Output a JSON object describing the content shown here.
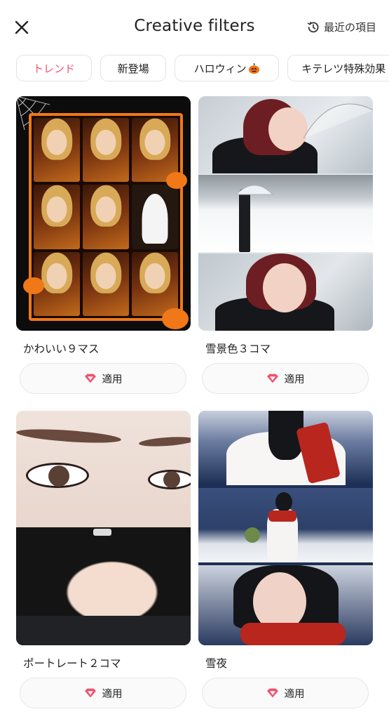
{
  "header": {
    "title": "Creative filters",
    "recent_label": "最近の項目"
  },
  "categories": [
    {
      "label": "トレンド",
      "active": true
    },
    {
      "label": "新登場",
      "active": false
    },
    {
      "label": "ハロウィン",
      "active": false
    },
    {
      "label": "キテレツ特殊効果",
      "active": false
    }
  ],
  "filters": [
    {
      "title": "かわいい９マス",
      "apply_label": "適用"
    },
    {
      "title": "雪景色３コマ",
      "apply_label": "適用"
    },
    {
      "title": "ポートレート２コマ",
      "apply_label": "適用"
    },
    {
      "title": "雪夜",
      "apply_label": "適用"
    }
  ],
  "colors": {
    "accent": "#f0516d",
    "chip_border": "#e3e3e3",
    "apply_bg": "#fafafa"
  },
  "icons": {
    "close": "close-icon",
    "recent": "history-icon",
    "halloween": "pumpkin-icon",
    "apply": "gem-icon"
  }
}
